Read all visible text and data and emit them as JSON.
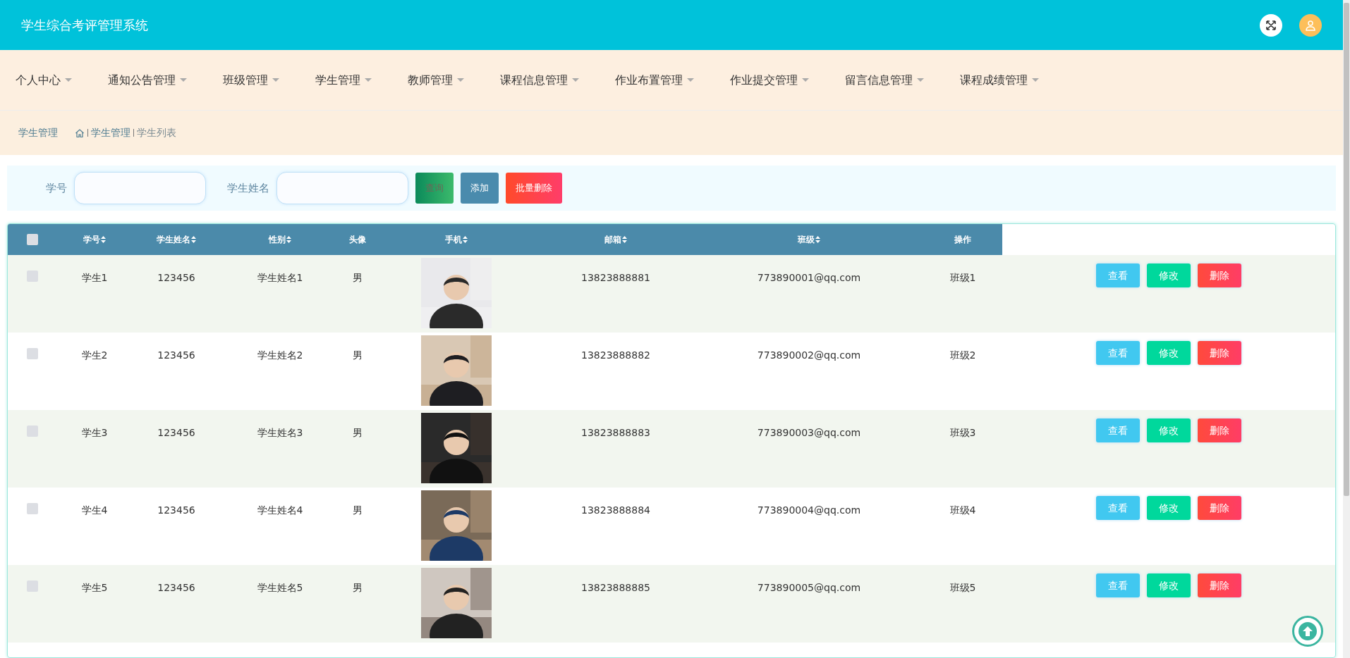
{
  "header": {
    "title": "学生综合考评管理系统"
  },
  "nav": [
    {
      "label": "个人中心"
    },
    {
      "label": "通知公告管理"
    },
    {
      "label": "班级管理"
    },
    {
      "label": "学生管理"
    },
    {
      "label": "教师管理"
    },
    {
      "label": "课程信息管理"
    },
    {
      "label": "作业布置管理"
    },
    {
      "label": "作业提交管理"
    },
    {
      "label": "留言信息管理"
    },
    {
      "label": "课程成绩管理"
    }
  ],
  "breadcrumb": {
    "page_title": "学生管理",
    "items": [
      "学生管理",
      "学生列表"
    ]
  },
  "search": {
    "fields": [
      {
        "label": "学号"
      },
      {
        "label": "学生姓名"
      }
    ],
    "buttons": [
      {
        "label": "查询",
        "kind": "query"
      },
      {
        "label": "添加",
        "kind": "add"
      },
      {
        "label": "批量删除",
        "kind": "delete"
      }
    ]
  },
  "table": {
    "header_checked": false,
    "columns": [
      {
        "label": "学号",
        "sortable": true
      },
      {
        "label": "学生姓名",
        "sortable": true
      },
      {
        "label": "性别",
        "sortable": true
      },
      {
        "label": "头像",
        "sortable": false
      },
      {
        "label": "手机",
        "sortable": true
      },
      {
        "label": "邮箱",
        "sortable": true
      },
      {
        "label": "班级",
        "sortable": true
      },
      {
        "label": "操作",
        "sortable": false
      }
    ],
    "rows": [
      {
        "checked": false,
        "cells": [
          "学生1",
          "123456",
          "学生姓名1",
          "男"
        ],
        "photo": {
          "kind": "picture"
        },
        "phone": "13823888881",
        "email": "773890001@qq.com",
        "class": "班级1",
        "actions": [
          {
            "label": "查看",
            "kind": "view"
          },
          {
            "label": "修改",
            "kind": "edit"
          },
          {
            "label": "删除",
            "kind": "delete"
          }
        ]
      },
      {
        "checked": false,
        "cells": [
          "学生2",
          "123456",
          "学生姓名2",
          "男"
        ],
        "photo": {
          "kind": "picture"
        },
        "phone": "13823888882",
        "email": "773890002@qq.com",
        "class": "班级2",
        "actions": [
          {
            "label": "查看",
            "kind": "view"
          },
          {
            "label": "修改",
            "kind": "edit"
          },
          {
            "label": "删除",
            "kind": "delete"
          }
        ]
      },
      {
        "checked": false,
        "cells": [
          "学生3",
          "123456",
          "学生姓名3",
          "男"
        ],
        "photo": {
          "kind": "picture"
        },
        "phone": "13823888883",
        "email": "773890003@qq.com",
        "class": "班级3",
        "actions": [
          {
            "label": "查看",
            "kind": "view"
          },
          {
            "label": "修改",
            "kind": "edit"
          },
          {
            "label": "删除",
            "kind": "delete"
          }
        ]
      },
      {
        "checked": false,
        "cells": [
          "学生4",
          "123456",
          "学生姓名4",
          "男"
        ],
        "photo": {
          "kind": "picture"
        },
        "phone": "13823888884",
        "email": "773890004@qq.com",
        "class": "班级4",
        "actions": [
          {
            "label": "查看",
            "kind": "view"
          },
          {
            "label": "修改",
            "kind": "edit"
          },
          {
            "label": "删除",
            "kind": "delete"
          }
        ]
      },
      {
        "checked": false,
        "cells": [
          "学生5",
          "123456",
          "学生姓名5",
          "男"
        ],
        "photo": {
          "kind": "picture"
        },
        "phone": "13823888885",
        "email": "773890005@qq.com",
        "class": "班级5",
        "actions": [
          {
            "label": "查看",
            "kind": "view"
          },
          {
            "label": "修改",
            "kind": "edit"
          },
          {
            "label": "删除",
            "kind": "delete"
          }
        ]
      }
    ]
  }
}
